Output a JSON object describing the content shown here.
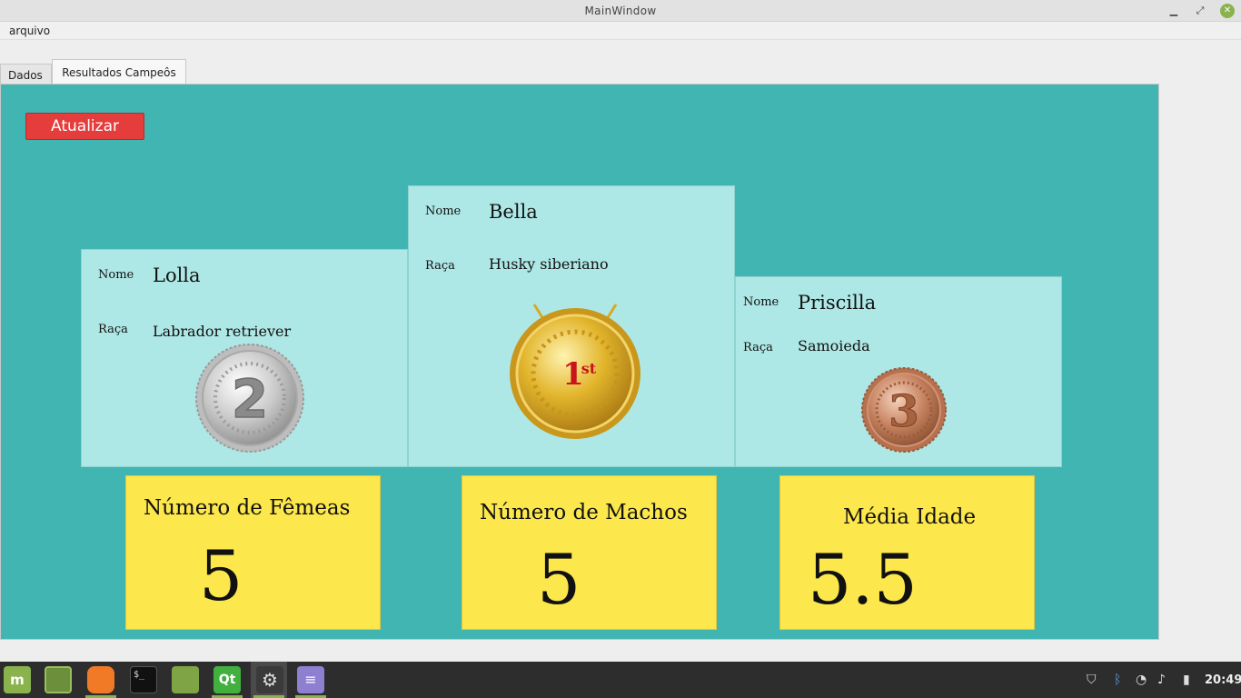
{
  "window": {
    "title": "MainWindow"
  },
  "menubar": {
    "items": [
      "arquivo"
    ]
  },
  "tabs": [
    {
      "label": "Dados",
      "active": false
    },
    {
      "label": "Resultados Campeôs",
      "active": true
    }
  ],
  "toolbar": {
    "refresh_label": "Atualizar"
  },
  "podium": {
    "first": {
      "name_label": "Nome",
      "name": "Bella",
      "breed_label": "Raça",
      "breed": "Husky siberiano",
      "medal": "gold-medal-1st-icon"
    },
    "second": {
      "name_label": "Nome",
      "name": "Lolla",
      "breed_label": "Raça",
      "breed": "Labrador retriever",
      "medal": "silver-medal-2-icon"
    },
    "third": {
      "name_label": "Nome",
      "name": "Priscilla",
      "breed_label": "Raça",
      "breed": "Samoieda",
      "medal": "bronze-medal-3-icon"
    }
  },
  "stats": {
    "females": {
      "label": "Número de Fêmeas",
      "value": "5"
    },
    "males": {
      "label": "Número de Machos",
      "value": "5"
    },
    "avg_age": {
      "label": "Média Idade",
      "value": "5.5"
    }
  },
  "colors": {
    "panel_bg": "#41b5b1",
    "card_bg": "#aee8e6",
    "stat_bg": "#fce74c",
    "button_bg": "#e53c3c",
    "accent": "#8ab34e"
  },
  "taskbar": {
    "apps": [
      "mint-menu-icon",
      "show-desktop-icon",
      "firefox-icon",
      "terminal-icon",
      "files-icon",
      "qt-creator-icon",
      "settings-icon",
      "text-editor-icon"
    ],
    "tray": [
      "shield-icon",
      "bluetooth-icon",
      "wifi-icon",
      "volume-icon",
      "battery-icon"
    ],
    "clock": "20:49"
  }
}
